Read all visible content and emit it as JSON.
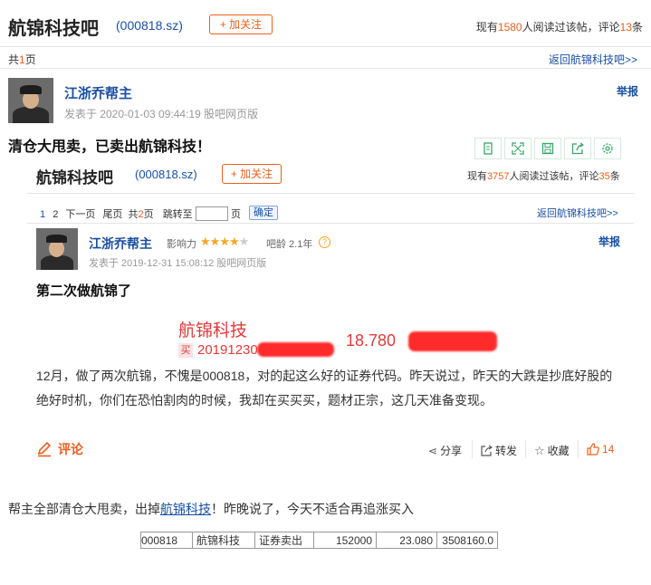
{
  "header": {
    "forum_name": "航锦科技吧",
    "stock_code": "(000818.sz)",
    "follow_label": "+ 加关注",
    "stats_prefix": "现有",
    "readers": "1580",
    "stats_mid": "人阅读过该帖，评论",
    "comments": "13",
    "stats_suffix": "条"
  },
  "pager": {
    "total_prefix": "共",
    "total_pages": "1",
    "total_suffix": "页",
    "back_link": "返回航锦科技吧>>"
  },
  "post": {
    "author": "江浙乔帮主",
    "meta": "发表于 2020-01-03 09:44:19 股吧网页版",
    "report": "举报",
    "title": "清仓大甩卖，已卖出航锦科技！"
  },
  "quoted": {
    "forum_name": "航锦科技吧",
    "stock_code": "(000818.sz)",
    "follow_label": "+ 加关注",
    "stats_prefix": "现有",
    "readers": "3757",
    "stats_mid": "人阅读过该帖，评论",
    "comments": "35",
    "stats_suffix": "条",
    "pager": {
      "page1": "1",
      "page2": "2",
      "next": "下一页",
      "last": "尾页",
      "total_prefix": "共",
      "total_pages": "2",
      "total_suffix": "页",
      "goto_label": "跳转至",
      "goto_suffix": "页",
      "confirm": "确定",
      "back_link": "返回航锦科技吧>>"
    },
    "author": "江浙乔帮主",
    "influence_label": "影响力",
    "influence_stars": 3.5,
    "age_label": "吧龄 2.1年",
    "meta": "发表于 2019-12-31 15:08:12 股吧网页版",
    "report": "举报",
    "title": "第二次做航锦了",
    "image": {
      "name": "航锦科技",
      "tag": "买",
      "date": "20191230",
      "price": "18.780"
    },
    "body": "12月，做了两次航锦，不愧是000818，对的起这么好的证券代码。昨天说过，昨天的大跌是抄底好股的绝好时机，你们在恐怕割肉的时候，我却在买买买，题材正宗，这几天准备变现。",
    "comment_label": "评论",
    "actions": {
      "share": "分享",
      "forward": "转发",
      "collect": "收藏",
      "likes": "14"
    }
  },
  "footer": {
    "text_before": "帮主全部清仓大甩卖，出掉",
    "link": "航锦科技",
    "text_after": "！昨晚说了，今天不适合再追涨买入"
  },
  "trade_row": [
    "000818",
    "航锦科技",
    "证券卖出",
    "152000",
    "23.080",
    "3508160.0"
  ]
}
